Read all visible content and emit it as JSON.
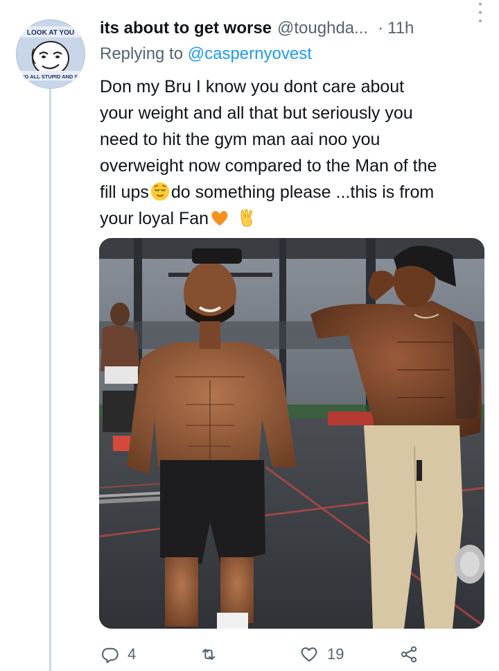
{
  "tweet": {
    "display_name": "its about to get worse",
    "handle": "@toughda...",
    "separator": "·",
    "time": "11h",
    "replying_prefix": "Replying to",
    "replying_to": "@caspernyovest",
    "body_lines": [
      "Don my Bru I know you dont care about",
      "your weight and all that but seriously you",
      "need to hit the gym man aai noo you",
      "overweight now compared to the Man of the",
      "fill ups",
      "do something please ...this is from",
      "your loyal Fan"
    ],
    "emojis": [
      "relieved-face-emoji",
      "orange-heart-emoji",
      "victory-hand-emoji"
    ]
  },
  "avatar": {
    "top_text": "LOOK AT YOU",
    "bottom_text": "ING ALL STUPID AND SH"
  },
  "media": {
    "description_icon": "gym-photo-two-men"
  },
  "actions": {
    "reply_count": "4",
    "retweet_count": "",
    "like_count": "19",
    "reply_icon": "reply-icon",
    "retweet_icon": "retweet-icon",
    "like_icon": "heart-icon",
    "share_icon": "share-icon"
  },
  "colors": {
    "text": "#0f1419",
    "secondary": "#536471",
    "link": "#1d9bf0",
    "thread": "#cfd9de"
  }
}
